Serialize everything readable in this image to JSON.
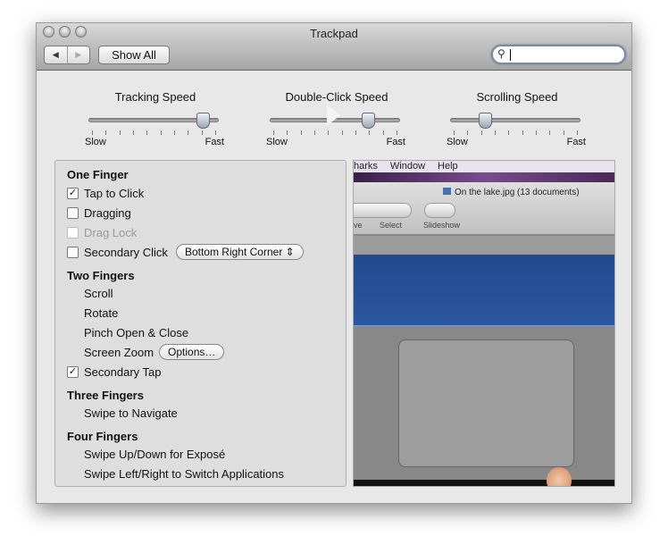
{
  "window": {
    "title": "Trackpad",
    "show_all": "Show All",
    "back": "◀",
    "forward": "▶",
    "search": {
      "value": "",
      "icon": "magnifier-icon"
    }
  },
  "sliders": [
    {
      "label": "Tracking Speed",
      "min": "Slow",
      "max": "Fast",
      "value": 0.9
    },
    {
      "label": "Double-Click Speed",
      "min": "Slow",
      "max": "Fast",
      "value": 0.77
    },
    {
      "label": "Scrolling Speed",
      "min": "Slow",
      "max": "Fast",
      "value": 0.25
    }
  ],
  "gestures": {
    "one_finger": "One Finger",
    "tap_to_click": {
      "label": "Tap to Click",
      "checked": true
    },
    "dragging": {
      "label": "Dragging",
      "checked": false
    },
    "drag_lock": {
      "label": "Drag Lock",
      "checked": false,
      "disabled": true
    },
    "secondary_click": {
      "label": "Secondary Click",
      "checked": false,
      "option": "Bottom Right Corner"
    },
    "two_fingers": "Two Fingers",
    "scroll": "Scroll",
    "rotate": "Rotate",
    "pinch": "Pinch Open & Close",
    "screen_zoom": "Screen Zoom",
    "options": "Options…",
    "secondary_tap": {
      "label": "Secondary Tap",
      "checked": true
    },
    "three_fingers": "Three Fingers",
    "swipe_navigate": "Swipe to Navigate",
    "four_fingers": "Four Fingers",
    "expose": "Swipe Up/Down for Exposé",
    "switch_apps": "Swipe Left/Right to Switch Applications"
  },
  "video": {
    "menu": [
      "harks",
      "Window",
      "Help"
    ],
    "doc": "On the lake.jpg (13 documents)",
    "tools": [
      "ve",
      "Select",
      "Slideshow"
    ]
  }
}
